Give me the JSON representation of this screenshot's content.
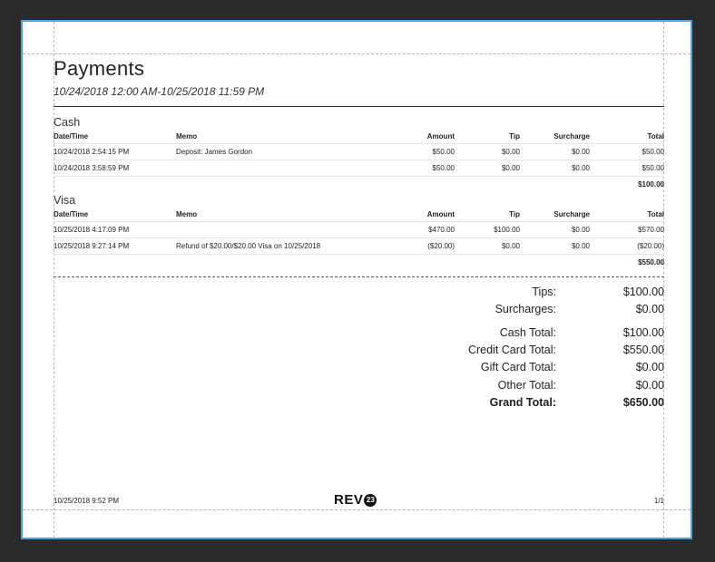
{
  "report": {
    "title": "Payments",
    "date_range": "10/24/2018 12:00 AM-10/25/2018 11:59 PM"
  },
  "columns": {
    "datetime": "Date/Time",
    "memo": "Memo",
    "amount": "Amount",
    "tip": "Tip",
    "surcharge": "Surcharge",
    "total": "Total"
  },
  "sections": [
    {
      "name": "Cash",
      "rows": [
        {
          "datetime": "10/24/2018 2:54:15 PM",
          "memo": "Deposit: James Gordon",
          "amount": "$50.00",
          "tip": "$0.00",
          "surcharge": "$0.00",
          "total": "$50.00"
        },
        {
          "datetime": "10/24/2018 3:58:59 PM",
          "memo": "",
          "amount": "$50.00",
          "tip": "$0.00",
          "surcharge": "$0.00",
          "total": "$50.00"
        }
      ],
      "subtotal": "$100.00"
    },
    {
      "name": "Visa",
      "rows": [
        {
          "datetime": "10/25/2018 4:17:09 PM",
          "memo": "",
          "amount": "$470.00",
          "tip": "$100.00",
          "surcharge": "$0.00",
          "total": "$570.00"
        },
        {
          "datetime": "10/25/2018 9:27:14 PM",
          "memo": "Refund of $20.00/$20.00 Visa on 10/25/2018",
          "amount": "($20.00)",
          "tip": "$0.00",
          "surcharge": "$0.00",
          "total": "($20.00)"
        }
      ],
      "subtotal": "$550.00"
    }
  ],
  "summary": {
    "tips_label": "Tips:",
    "tips_value": "$100.00",
    "surcharges_label": "Surcharges:",
    "surcharges_value": "$0.00",
    "cash_label": "Cash Total:",
    "cash_value": "$100.00",
    "credit_label": "Credit Card Total:",
    "credit_value": "$550.00",
    "gift_label": "Gift Card Total:",
    "gift_value": "$0.00",
    "other_label": "Other Total:",
    "other_value": "$0.00",
    "grand_label": "Grand Total:",
    "grand_value": "$650.00"
  },
  "footer": {
    "printed": "10/25/2018 9:52 PM",
    "logo_text": "REV",
    "logo_badge": "23",
    "page": "1/1"
  },
  "colors": {
    "background": "#2a2a2a",
    "page_border": "#4aa3df"
  }
}
